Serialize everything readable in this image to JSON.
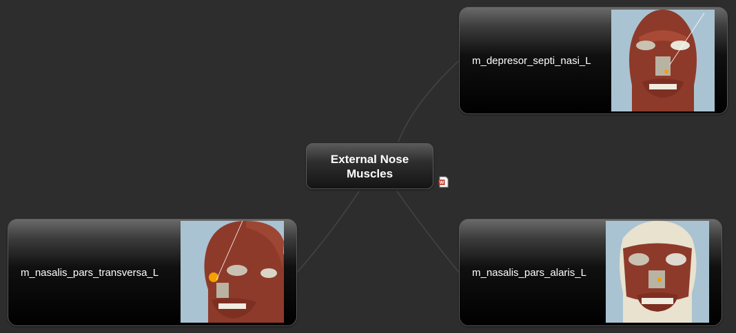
{
  "central_topic": {
    "title": "External Nose Muscles"
  },
  "topics": [
    {
      "label": "m_depresor_septi_nasi_L",
      "image": "face-anatomy-frontal-thumbnail"
    },
    {
      "label": "m_nasalis_pars_transversa_L",
      "image": "face-anatomy-oblique-thumbnail"
    },
    {
      "label": "m_nasalis_pars_alaris_L",
      "image": "face-anatomy-skull-frontal-thumbnail"
    }
  ],
  "icons": {
    "attachment": "word-document-icon"
  },
  "colors": {
    "background": "#2d2d2d",
    "muscle": "#8e3a2a",
    "skin_bg": "#a9c3d2",
    "bone": "#e8e2cf",
    "highlight": "#f4a000"
  }
}
